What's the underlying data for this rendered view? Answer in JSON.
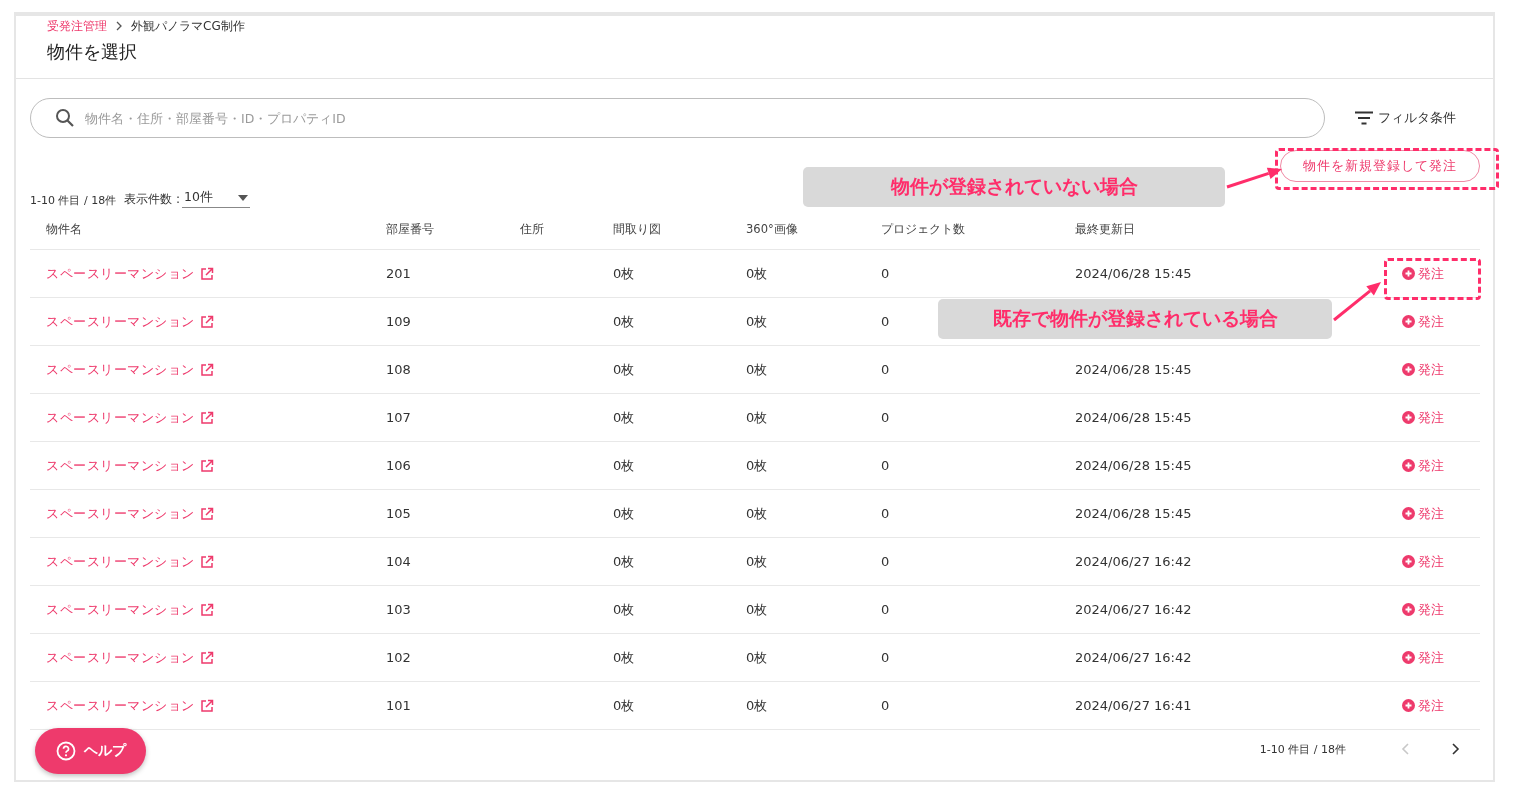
{
  "breadcrumb": [
    {
      "label": "受発注管理",
      "link": true
    },
    {
      "label": "外観パノラマCG制作",
      "link": false
    }
  ],
  "page_title": "物件を選択",
  "search": {
    "placeholder": "物件名・住所・部屋番号・ID・プロパティID"
  },
  "filter_button": "フィルタ条件",
  "new_button": "物件を新規登録して発注",
  "range_text": "1-10 件目 / 18件",
  "page_size": {
    "label": "表示件数 :",
    "value": "10件"
  },
  "columns": [
    "物件名",
    "部屋番号",
    "住所",
    "間取り図",
    "360°画像",
    "プロジェクト数",
    "最終更新日"
  ],
  "rows": [
    {
      "name": "スペースリーマンション",
      "room": "201",
      "floor_plan": "0枚",
      "panorama": "0枚",
      "projects": "0",
      "updated": "2024/06/28 15:45",
      "action": "発注"
    },
    {
      "name": "スペースリーマンション",
      "room": "109",
      "floor_plan": "0枚",
      "panorama": "0枚",
      "projects": "0",
      "action": "発注"
    },
    {
      "name": "スペースリーマンション",
      "room": "108",
      "floor_plan": "0枚",
      "panorama": "0枚",
      "projects": "0",
      "updated": "2024/06/28 15:45",
      "action": "発注"
    },
    {
      "name": "スペースリーマンション",
      "room": "107",
      "floor_plan": "0枚",
      "panorama": "0枚",
      "projects": "0",
      "updated": "2024/06/28 15:45",
      "action": "発注"
    },
    {
      "name": "スペースリーマンション",
      "room": "106",
      "floor_plan": "0枚",
      "panorama": "0枚",
      "projects": "0",
      "updated": "2024/06/28 15:45",
      "action": "発注"
    },
    {
      "name": "スペースリーマンション",
      "room": "105",
      "floor_plan": "0枚",
      "panorama": "0枚",
      "projects": "0",
      "updated": "2024/06/28 15:45",
      "action": "発注"
    },
    {
      "name": "スペースリーマンション",
      "room": "104",
      "floor_plan": "0枚",
      "panorama": "0枚",
      "projects": "0",
      "updated": "2024/06/27 16:42",
      "action": "発注"
    },
    {
      "name": "スペースリーマンション",
      "room": "103",
      "floor_plan": "0枚",
      "panorama": "0枚",
      "projects": "0",
      "updated": "2024/06/27 16:42",
      "action": "発注"
    },
    {
      "name": "スペースリーマンション",
      "room": "102",
      "floor_plan": "0枚",
      "panorama": "0枚",
      "projects": "0",
      "updated": "2024/06/27 16:42",
      "action": "発注"
    },
    {
      "name": "スペースリーマンション",
      "room": "101",
      "floor_plan": "0枚",
      "panorama": "0枚",
      "projects": "0",
      "updated": "2024/06/27 16:41",
      "action": "発注"
    }
  ],
  "pagination": {
    "range": "1-10 件目 / 18件",
    "prev": {
      "disabled": true
    },
    "next": {
      "disabled": false
    }
  },
  "help_button": "ヘルプ",
  "annotations": [
    {
      "kind": "new",
      "text": "物件が登録されていない場合"
    },
    {
      "kind": "existing",
      "text": "既存で物件が登録されている場合"
    }
  ]
}
